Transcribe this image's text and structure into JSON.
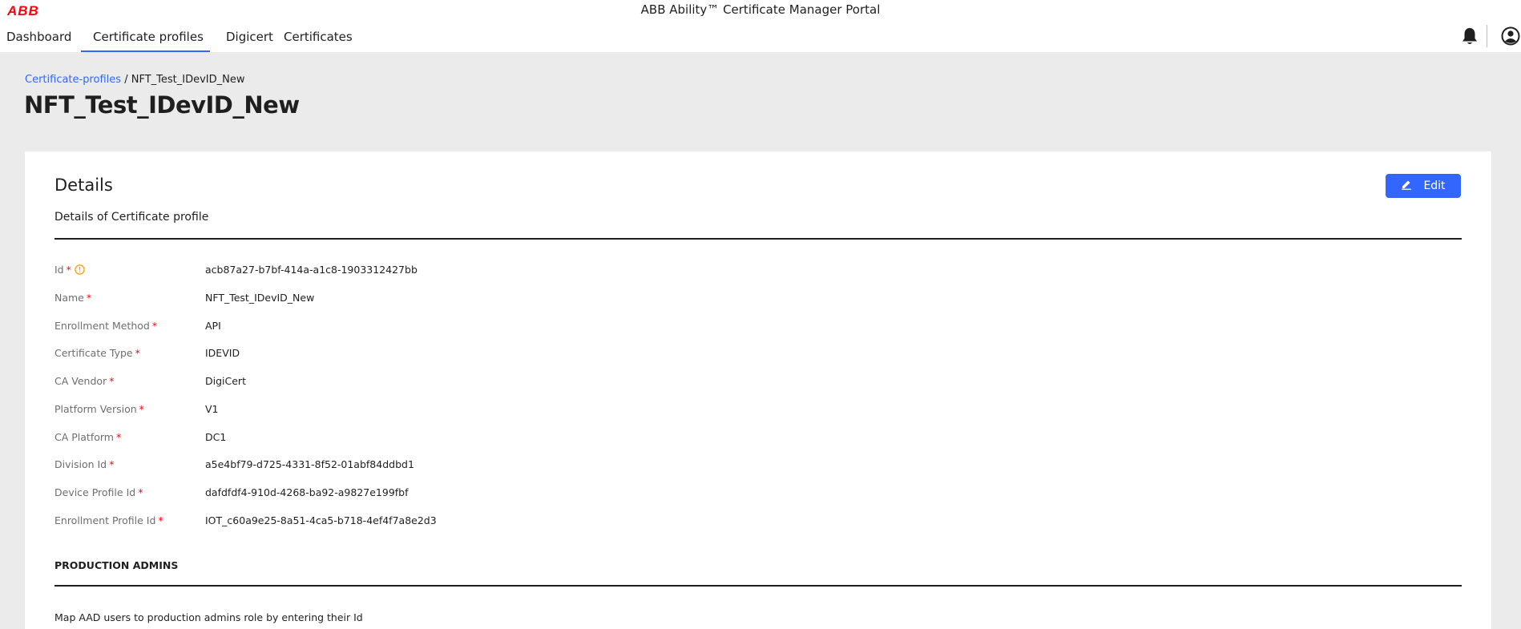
{
  "header": {
    "logo": "ABB",
    "app_title": "ABB Ability™ Certificate Manager Portal",
    "nav": [
      {
        "label": "Dashboard",
        "active": false
      },
      {
        "label": "Certificate profiles",
        "active": true
      },
      {
        "label": "Digicert",
        "active": false
      },
      {
        "label": "Certificates",
        "active": false
      }
    ],
    "icons": [
      "bell-icon",
      "user-icon"
    ]
  },
  "breadcrumb": {
    "link": "Certificate-profiles",
    "separator": " / ",
    "current": "NFT_Test_IDevID_New"
  },
  "page_title": "NFT_Test_IDevID_New",
  "details": {
    "title": "Details",
    "subtitle": "Details of Certificate profile",
    "edit_label": "Edit",
    "required_mark": "*",
    "fields": [
      {
        "label": "Id",
        "value": "acb87a27-b7bf-414a-a1c8-1903312427bb",
        "has_info": true
      },
      {
        "label": "Name",
        "value": "NFT_Test_IDevID_New"
      },
      {
        "label": "Enrollment Method",
        "value": "API"
      },
      {
        "label": "Certificate Type",
        "value": "IDEVID"
      },
      {
        "label": "CA Vendor",
        "value": "DigiCert"
      },
      {
        "label": "Platform Version",
        "value": "V1"
      },
      {
        "label": "CA Platform",
        "value": "DC1"
      },
      {
        "label": "Division Id",
        "value": "a5e4bf79-d725-4331-8f52-01abf84ddbd1"
      },
      {
        "label": "Device Profile Id",
        "value": "dafdfdf4-910d-4268-ba92-a9827e199fbf"
      },
      {
        "label": "Enrollment Profile Id",
        "value": "IOT_c60a9e25-8a51-4ca5-b718-4ef4f7a8e2d3"
      }
    ]
  },
  "production_admins": {
    "title": "PRODUCTION ADMINS",
    "description": "Map AAD users to production admins role by entering their Id"
  },
  "colors": {
    "accent": "#3366ff",
    "brand": "#ff000f",
    "background": "#ebebeb"
  }
}
